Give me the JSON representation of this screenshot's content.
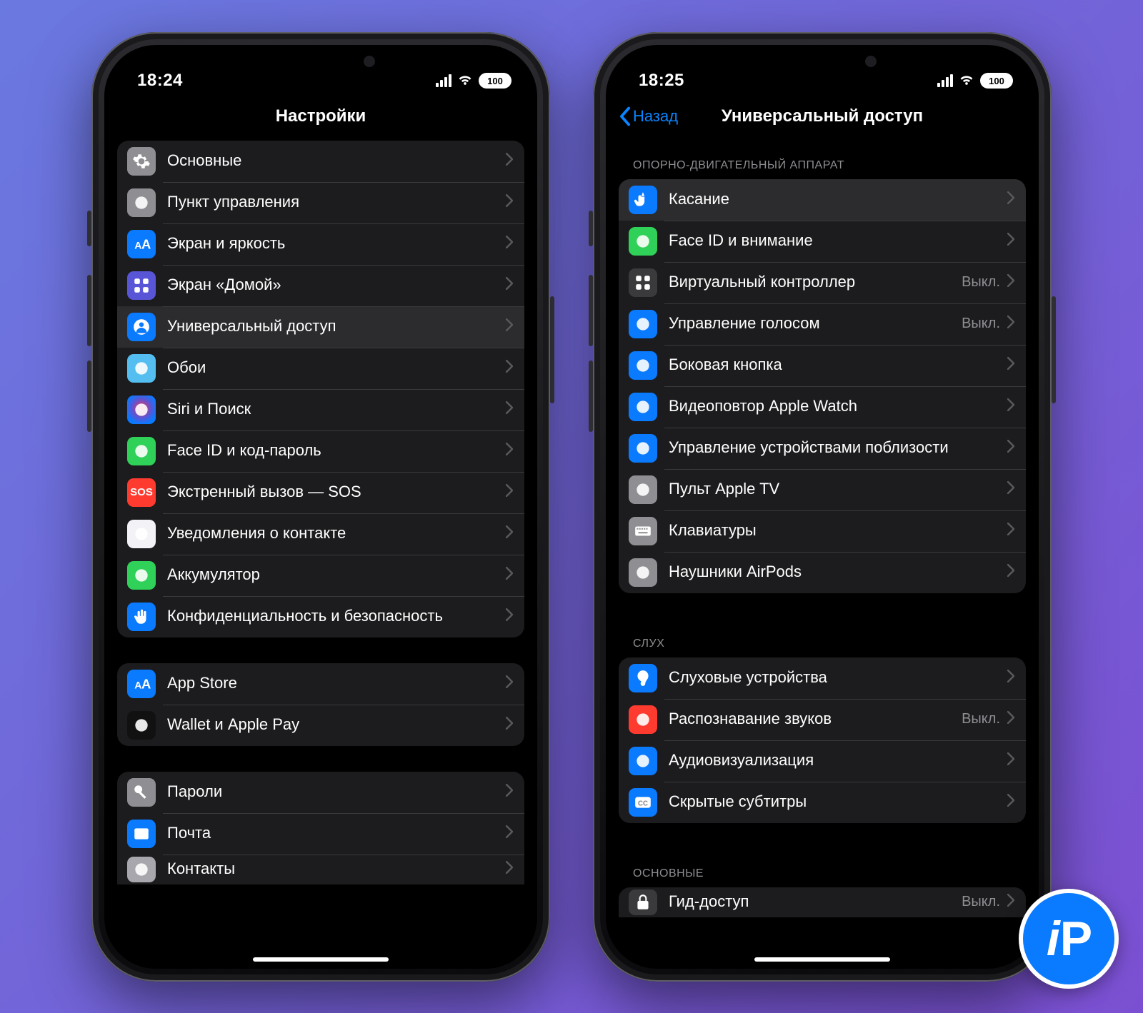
{
  "badge": "iP",
  "leftPhone": {
    "status": {
      "time": "18:24",
      "battery": "100"
    },
    "nav": {
      "title": "Настройки",
      "back": null
    },
    "groups": [
      {
        "items": [
          {
            "icon": "gear-icon",
            "iconBg": "bg-gray",
            "label": "Основные"
          },
          {
            "icon": "switches-icon",
            "iconBg": "bg-gray",
            "label": "Пункт управления"
          },
          {
            "icon": "text-size-icon",
            "iconBg": "bg-blue",
            "label": "Экран и яркость"
          },
          {
            "icon": "homegrid-icon",
            "iconBg": "bg-indigo",
            "label": "Экран «Домой»"
          },
          {
            "icon": "accessibility-icon",
            "iconBg": "bg-blue",
            "label": "Универсальный доступ",
            "highlight": true
          },
          {
            "icon": "wallpaper-icon",
            "iconBg": "bg-cyan",
            "label": "Обои"
          },
          {
            "icon": "siri-icon",
            "iconBg": "bg-grad-siri",
            "label": "Siri и Поиск"
          },
          {
            "icon": "faceid-icon",
            "iconBg": "bg-green",
            "label": "Face ID и код-пароль"
          },
          {
            "icon": "sos-icon",
            "iconBg": "bg-red",
            "label": "Экстренный вызов — SOS"
          },
          {
            "icon": "exposure-icon",
            "iconBg": "bg-white",
            "label": "Уведомления о контакте"
          },
          {
            "icon": "battery-icon",
            "iconBg": "bg-green",
            "label": "Аккумулятор"
          },
          {
            "icon": "hand-privacy-icon",
            "iconBg": "bg-blue",
            "label": "Конфиденциальность и безопасность"
          }
        ]
      },
      {
        "items": [
          {
            "icon": "appstore-icon",
            "iconBg": "bg-blue",
            "label": "App Store"
          },
          {
            "icon": "wallet-icon",
            "iconBg": "bg-black",
            "label": "Wallet и Apple Pay"
          }
        ]
      },
      {
        "partial": true,
        "items": [
          {
            "icon": "key-icon",
            "iconBg": "bg-gray",
            "label": "Пароли"
          },
          {
            "icon": "mail-icon",
            "iconBg": "bg-blue",
            "label": "Почта"
          },
          {
            "icon": "contacts-icon",
            "iconBg": "bg-gray2",
            "label": "Контакты",
            "partial": true
          }
        ]
      }
    ]
  },
  "rightPhone": {
    "status": {
      "time": "18:25",
      "battery": "100"
    },
    "nav": {
      "title": "Универсальный доступ",
      "back": "Назад"
    },
    "sections": [
      {
        "header": "ОПОРНО-ДВИГАТЕЛЬНЫЙ АППАРАТ",
        "items": [
          {
            "icon": "touch-icon",
            "iconBg": "bg-blue",
            "label": "Касание",
            "highlight": true
          },
          {
            "icon": "faceid-icon",
            "iconBg": "bg-green",
            "label": "Face ID и внимание"
          },
          {
            "icon": "switchctl-icon",
            "iconBg": "bg-darkgray",
            "label": "Виртуальный контроллер",
            "detail": "Выкл."
          },
          {
            "icon": "voicectl-icon",
            "iconBg": "bg-blue",
            "label": "Управление голосом",
            "detail": "Выкл."
          },
          {
            "icon": "sidebutton-icon",
            "iconBg": "bg-blue",
            "label": "Боковая кнопка"
          },
          {
            "icon": "watch-icon",
            "iconBg": "bg-blue",
            "label": "Видеоповтор Apple Watch"
          },
          {
            "icon": "nearby-icon",
            "iconBg": "bg-blue",
            "label": "Управление устройствами поблизости"
          },
          {
            "icon": "tvremote-icon",
            "iconBg": "bg-gray",
            "label": "Пульт Apple TV"
          },
          {
            "icon": "keyboard-icon",
            "iconBg": "bg-gray",
            "label": "Клавиатуры"
          },
          {
            "icon": "airpods-icon",
            "iconBg": "bg-gray",
            "label": "Наушники AirPods"
          }
        ]
      },
      {
        "header": "СЛУХ",
        "items": [
          {
            "icon": "ear-icon",
            "iconBg": "bg-blue",
            "label": "Слуховые устройства"
          },
          {
            "icon": "sound-rec-icon",
            "iconBg": "bg-red",
            "label": "Распознавание звуков",
            "detail": "Выкл."
          },
          {
            "icon": "audiovis-icon",
            "iconBg": "bg-blue",
            "label": "Аудиовизуализация"
          },
          {
            "icon": "cc-icon",
            "iconBg": "bg-blue",
            "label": "Скрытые субтитры"
          }
        ]
      },
      {
        "header": "ОСНОВНЫЕ",
        "partial": true,
        "items": [
          {
            "icon": "guided-icon",
            "iconBg": "bg-darkgray",
            "label": "Гид-доступ",
            "detail": "Выкл.",
            "partial": true
          }
        ]
      }
    ]
  }
}
